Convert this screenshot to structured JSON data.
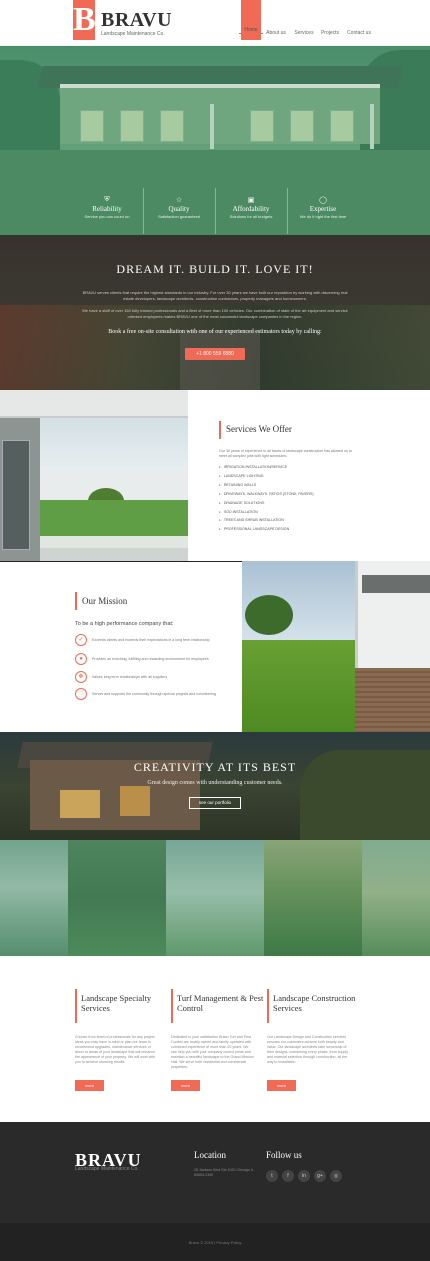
{
  "header": {
    "logo_letter": "B",
    "logo_name": "BRAVU",
    "logo_tagline": "Landscape Maintenance Co.",
    "nav": [
      "Home",
      "About us",
      "Services",
      "Projects",
      "Contact us"
    ]
  },
  "hero": {
    "features": [
      {
        "icon": "shield-icon",
        "title": "Reliability",
        "sub": "Service you can count on"
      },
      {
        "icon": "star-icon",
        "title": "Quality",
        "sub": "Satisfaction guaranteed"
      },
      {
        "icon": "chart-icon",
        "title": "Affordability",
        "sub": "Solutions for all budgets"
      },
      {
        "icon": "lightbulb-icon",
        "title": "Expertise",
        "sub": "We do it right the first time"
      }
    ]
  },
  "dream": {
    "title": "DREAM IT. BUILD IT. LOVE IT!",
    "p1": "BRAVU serves clients that require the highest standards in our industry. For over 30 years we have built our reputation by working with discerning real estate developers, landscape architects, construction contractors, property managers and homeowners.",
    "p2": "We have a staff of over 160 fully trained professionals and a fleet of more than 100 vehicles. Our combination of state of the art equipment and service oriented employees makes BRAVU one of the most successful landscape companies in the region.",
    "call": "Book a free on-site consultation with one of our experienced estimators today by calling:",
    "phone": "+1 800 559 6580"
  },
  "services_offer": {
    "title": "Services We Offer",
    "intro": "Our 30 years of experience in all facets of landscape construction has allowed us to meet all complex jobs with tight schedules:",
    "items": [
      "IRRIGATION INSTALLATION/SERVICE",
      "LANDSCAPE LIGHTING",
      "RETAINING WALLS",
      "DRIVEWAYS, WALKWAYS, PATIOS (STONE, PAVERS)",
      "DRAINAGE SOLUTIONS",
      "SOD INSTALLATION",
      "TREES AND SHRUB INSTALLATION",
      "PROFESSIONAL LANDSCAPE DESIGN"
    ]
  },
  "mission": {
    "title": "Our Mission",
    "lead": "To be a high performance company that:",
    "items": [
      {
        "icon": "check-icon",
        "text": "Exceeds clients and exceeds their expectations in a long term relationship"
      },
      {
        "icon": "people-icon",
        "text": "Provides an enriching, fulfilling and rewarding environment for employees"
      },
      {
        "icon": "handshake-icon",
        "text": "Values long term relationships with all suppliers"
      },
      {
        "icon": "heart-icon",
        "text": "Serves and supports the community through special projects and volunteering"
      }
    ]
  },
  "creativity": {
    "title": "CREATIVITY AT ITS BEST",
    "sub": "Great design comes with understanding customer needs.",
    "button": "see our portfolio"
  },
  "columns": [
    {
      "title": "Landscape Specialty Services",
      "text": "Choose from team of professionals for any project ideas you may have in mind or plan our team to recommend upgrades, maintenance services or decor to areas of your landscape that will enhance the appearance of your property. We will work with you to achieve stunning results.",
      "button": "more"
    },
    {
      "title": "Turf Management & Pest Control",
      "text": "Dedicated to your satisfaction Bravu Turf and Pest Control are locally owned and family operated with combined experience of more than 20 years. We can help you with your company control pests and maintain a beautiful landscape to the Grand Mission Hall. We serve both residential and commercial properties.",
      "button": "more"
    },
    {
      "title": "Landscape Construction Services",
      "text": "Our Landscape Design and Construction services ensures our customers achieve both beauty and value. Our landscape architects take ownership of their designs, overseeing every phase, from supply and material selection through construction, all the way to installation.",
      "button": "more"
    }
  ],
  "footer": {
    "logo": "BRAVU",
    "logo_tagline": "Landscape Maintenance Co.",
    "location_title": "Location",
    "location_text": "28 Jackson Blvd Ste 1020 Chicago IL 60604-2340",
    "follow_title": "Follow us",
    "social": [
      {
        "icon": "twitter-icon",
        "glyph": "t"
      },
      {
        "icon": "facebook-icon",
        "glyph": "f"
      },
      {
        "icon": "linkedin-icon",
        "glyph": "in"
      },
      {
        "icon": "google-plus-icon",
        "glyph": "g+"
      },
      {
        "icon": "dribbble-icon",
        "glyph": "◎"
      }
    ],
    "copyright": "Bravu © 2015 | Privacy Policy"
  },
  "colors": {
    "accent": "#f06a55",
    "footer": "#2a2a2a"
  }
}
